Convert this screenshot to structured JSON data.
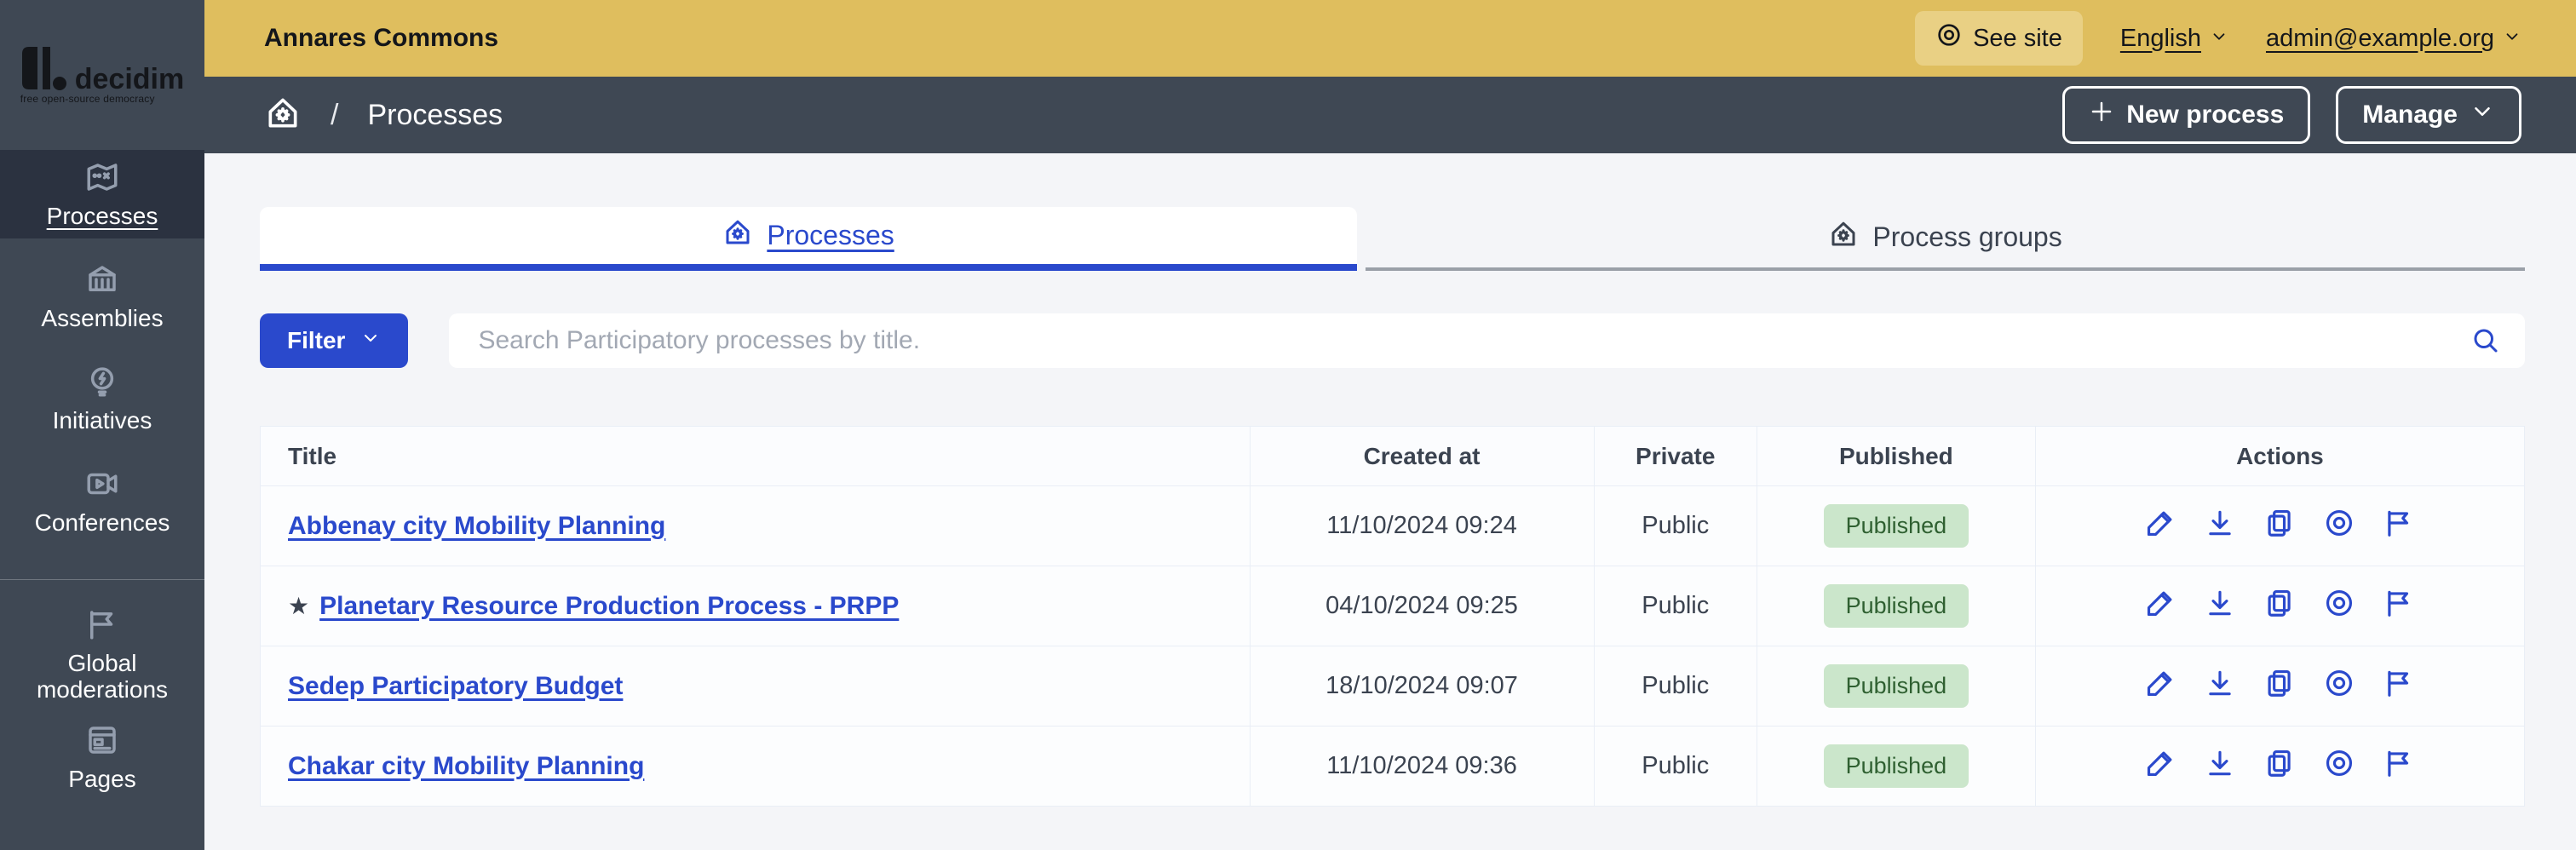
{
  "brand": {
    "logo_word": "decidim",
    "logo_tagline": "free open-source democracy"
  },
  "topbar": {
    "title": "Annares Commons",
    "see_site_label": "See site",
    "language_label": "English",
    "account_label": "admin@example.org"
  },
  "breadcrumb": {
    "current": "Processes"
  },
  "subheader": {
    "new_process_label": "New process",
    "manage_label": "Manage"
  },
  "sidebar": {
    "items": [
      {
        "label": "Processes",
        "icon": "map-icon",
        "active": true
      },
      {
        "label": "Assemblies",
        "icon": "bank-icon",
        "active": false
      },
      {
        "label": "Initiatives",
        "icon": "lightbulb-icon",
        "active": false
      },
      {
        "label": "Conferences",
        "icon": "video-icon",
        "active": false
      },
      {
        "label": "Global moderations",
        "icon": "flag-icon",
        "active": false
      },
      {
        "label": "Pages",
        "icon": "pages-icon",
        "active": false
      }
    ]
  },
  "tabs": [
    {
      "label": "Processes",
      "active": true
    },
    {
      "label": "Process groups",
      "active": false
    }
  ],
  "filter": {
    "button_label": "Filter"
  },
  "search": {
    "placeholder": "Search Participatory processes by title."
  },
  "table": {
    "headers": [
      "Title",
      "Created at",
      "Private",
      "Published",
      "Actions"
    ],
    "rows": [
      {
        "title": "Abbenay city Mobility Planning",
        "starred": false,
        "created_at": "11/10/2024 09:24",
        "private": "Public",
        "published": "Published"
      },
      {
        "title": "Planetary Resource Production Process - PRPP",
        "starred": true,
        "created_at": "04/10/2024 09:25",
        "private": "Public",
        "published": "Published"
      },
      {
        "title": "Sedep Participatory Budget",
        "starred": false,
        "created_at": "18/10/2024 09:07",
        "private": "Public",
        "published": "Published"
      },
      {
        "title": "Chakar city Mobility Planning",
        "starred": false,
        "created_at": "11/10/2024 09:36",
        "private": "Public",
        "published": "Published"
      }
    ],
    "row_actions": [
      {
        "name": "edit",
        "icon": "pencil-icon"
      },
      {
        "name": "export",
        "icon": "download-icon"
      },
      {
        "name": "duplicate",
        "icon": "copy-icon"
      },
      {
        "name": "preview",
        "icon": "eye-icon"
      },
      {
        "name": "moderations",
        "icon": "flag-small-icon"
      }
    ]
  },
  "colors": {
    "topbar_yellow": "#dfbe5e",
    "see_site_chip": "#e9d084",
    "rail_slate": "#3f4854",
    "rail_active": "#2b3240",
    "accent_blue": "#2a49cc",
    "badge_green_bg": "#cbe6cb",
    "badge_green_text": "#2f6031",
    "page_bg": "#f4f5f8"
  }
}
